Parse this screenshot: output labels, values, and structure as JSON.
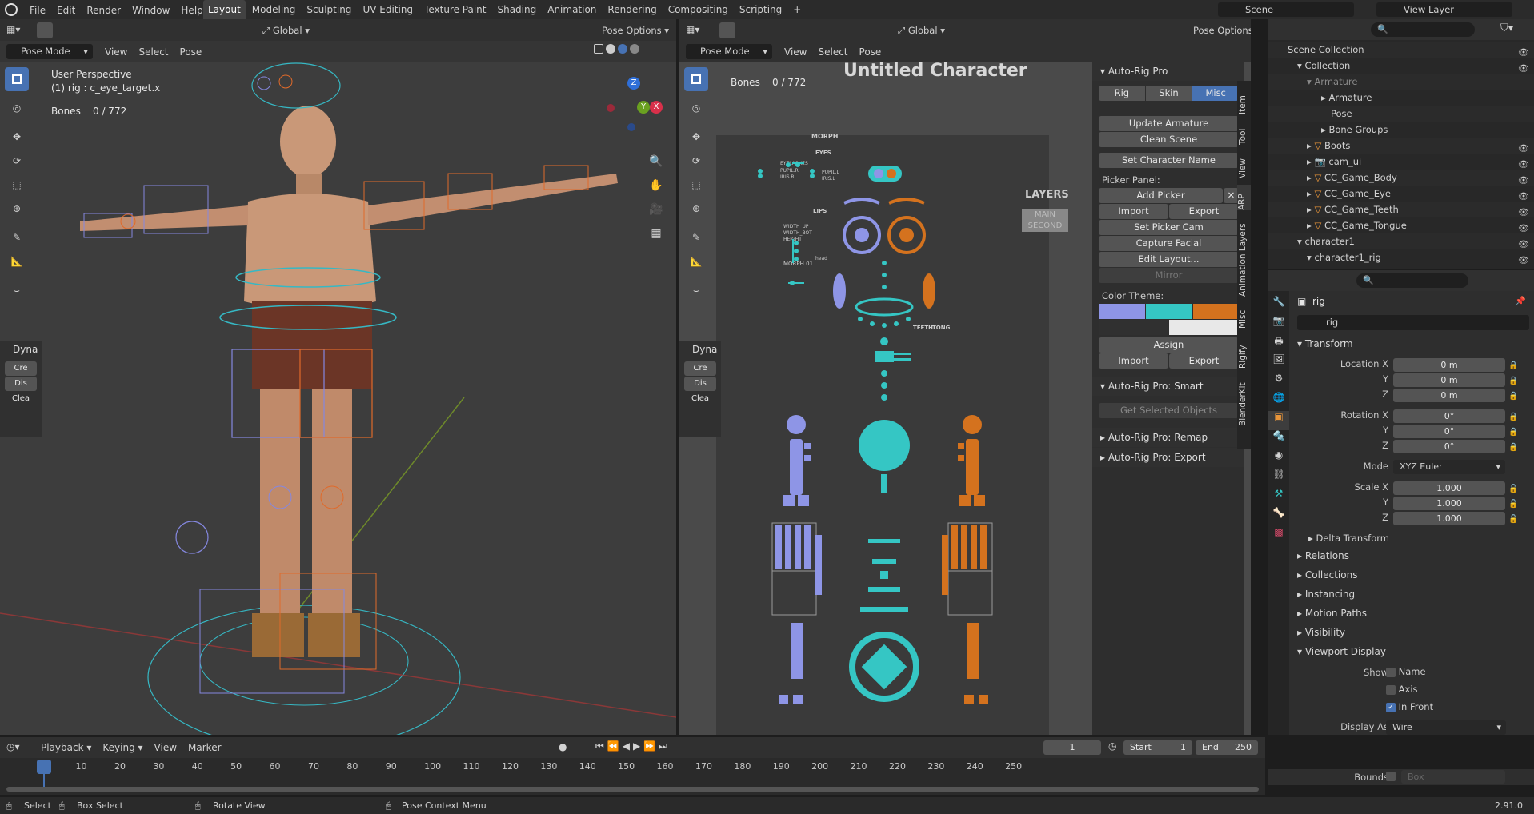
{
  "menubar": {
    "items": [
      "File",
      "Edit",
      "Render",
      "Window",
      "Help"
    ]
  },
  "workspaces": [
    {
      "label": "Layout",
      "active": true
    },
    {
      "label": "Modeling"
    },
    {
      "label": "Sculpting"
    },
    {
      "label": "UV Editing"
    },
    {
      "label": "Texture Paint"
    },
    {
      "label": "Shading"
    },
    {
      "label": "Animation"
    },
    {
      "label": "Rendering"
    },
    {
      "label": "Compositing"
    },
    {
      "label": "Scripting"
    }
  ],
  "scene": {
    "name": "Scene",
    "view_layer": "View Layer"
  },
  "viewport_left": {
    "mode": "Pose Mode",
    "menus": [
      "View",
      "Select",
      "Pose"
    ],
    "orientation": "Global",
    "pose_options": "Pose Options",
    "overlay_title": "User Perspective",
    "overlay_rig": "(1) rig : c_eye_target.x",
    "bones_label": "Bones",
    "bones_value": "0 / 772",
    "dyna_panel": {
      "title": "Dyna",
      "items": [
        "Cre",
        "Dis",
        "Clea"
      ]
    }
  },
  "viewport_right": {
    "mode": "Pose Mode",
    "menus": [
      "View",
      "Select",
      "Pose"
    ],
    "orientation": "Global",
    "pose_options": "Pose Options",
    "bones_label": "Bones",
    "bones_value": "0 / 772",
    "picker_title": "Untitled Character",
    "picker_labels": {
      "morph": "MORPH",
      "eyes": "EYES",
      "lips": "LIPS",
      "eyelashes": "EYELASHES",
      "pupil_r": "PUPIL.R",
      "iris_r": "IRIS.R",
      "pupil_l": "PUPIL.L",
      "iris_l": "IRIS.L",
      "width_up": "WIDTH_UP",
      "width_bot": "WIDTH_BOT",
      "height": "HEIGHT",
      "morph01": "MORPH 01",
      "head": "head",
      "layers": "LAYERS",
      "main": "MAIN",
      "second": "SECOND",
      "teeth": "TEETH",
      "tong": "TONG"
    },
    "dyna_panel": {
      "title": "Dyna",
      "items": [
        "Cre",
        "Dis",
        "Clea"
      ]
    }
  },
  "n_panel": {
    "header": "Auto-Rig Pro",
    "tabs": [
      {
        "label": "Rig"
      },
      {
        "label": "Skin"
      },
      {
        "label": "Misc",
        "active": true
      }
    ],
    "buttons": {
      "update": "Update Armature",
      "clean": "Clean Scene",
      "set_name": "Set Character Name"
    },
    "picker_panel_label": "Picker Panel:",
    "add_picker": "Add Picker",
    "import": "Import",
    "export": "Export",
    "set_picker_cam": "Set Picker Cam",
    "capture_facial": "Capture Facial",
    "edit_layout": "Edit Layout...",
    "mirror": "Mirror",
    "color_theme_label": "Color Theme:",
    "colors": [
      "#8e95e6",
      "#35c6c4",
      "#d4721e",
      "#e8e8e8"
    ],
    "assign": "Assign",
    "import2": "Import",
    "export2": "Export",
    "smart_header": "Auto-Rig Pro: Smart",
    "get_selected": "Get Selected Objects",
    "remap_header": "Auto-Rig Pro: Remap",
    "export_header": "Auto-Rig Pro: Export",
    "side_tabs": [
      "Item",
      "Tool",
      "View",
      "ARP",
      "Animation Layers",
      "Misc",
      "Rigify",
      "BlenderKit"
    ]
  },
  "outliner": {
    "rows": [
      {
        "label": "Scene Collection",
        "indent": 0
      },
      {
        "label": "Collection",
        "indent": 1
      },
      {
        "label": "Armature",
        "indent": 2
      },
      {
        "label": "Armature",
        "indent": 3
      },
      {
        "label": "Pose",
        "indent": 3
      },
      {
        "label": "Bone Groups",
        "indent": 3
      },
      {
        "label": "Boots",
        "indent": 2
      },
      {
        "label": "cam_ui",
        "indent": 2
      },
      {
        "label": "CC_Game_Body",
        "indent": 2
      },
      {
        "label": "CC_Game_Eye",
        "indent": 2
      },
      {
        "label": "CC_Game_Teeth",
        "indent": 2
      },
      {
        "label": "CC_Game_Tongue",
        "indent": 2
      },
      {
        "label": "character1",
        "indent": 1
      },
      {
        "label": "character1_rig",
        "indent": 2
      }
    ]
  },
  "properties": {
    "object_name": "rig",
    "data_name": "rig",
    "transform_header": "Transform",
    "location": {
      "label": "Location X",
      "x": "0 m",
      "y": "0 m",
      "z": "0 m"
    },
    "rotation": {
      "label": "Rotation X",
      "x": "0°",
      "y": "0°",
      "z": "0°"
    },
    "mode_label": "Mode",
    "mode_value": "XYZ Euler",
    "scale": {
      "label": "Scale X",
      "x": "1.000",
      "y": "1.000",
      "z": "1.000"
    },
    "axis_y": "Y",
    "axis_z": "Z",
    "delta": "Delta Transform",
    "sections": [
      "Relations",
      "Collections",
      "Instancing",
      "Motion Paths",
      "Visibility"
    ],
    "viewport_display": "Viewport Display",
    "show_label": "Show",
    "show_name": "Name",
    "show_axis": "Axis",
    "show_infront": "In Front",
    "display_as_label": "Display As",
    "display_as_value": "Wire",
    "bounds_label": "Bounds",
    "bounds_value": "Box"
  },
  "timeline": {
    "menus": [
      "Playback",
      "Keying",
      "View",
      "Marker"
    ],
    "current_frame": "1",
    "start_label": "Start",
    "start": "1",
    "end_label": "End",
    "end": "250",
    "ticks": [
      "1",
      "10",
      "20",
      "30",
      "40",
      "50",
      "60",
      "70",
      "80",
      "90",
      "100",
      "110",
      "120",
      "130",
      "140",
      "150",
      "160",
      "170",
      "180",
      "190",
      "200",
      "210",
      "220",
      "230",
      "240",
      "250"
    ]
  },
  "statusbar": {
    "select": "Select",
    "box_select": "Box Select",
    "rotate": "Rotate View",
    "context": "Pose Context Menu",
    "version": "2.91.0"
  }
}
